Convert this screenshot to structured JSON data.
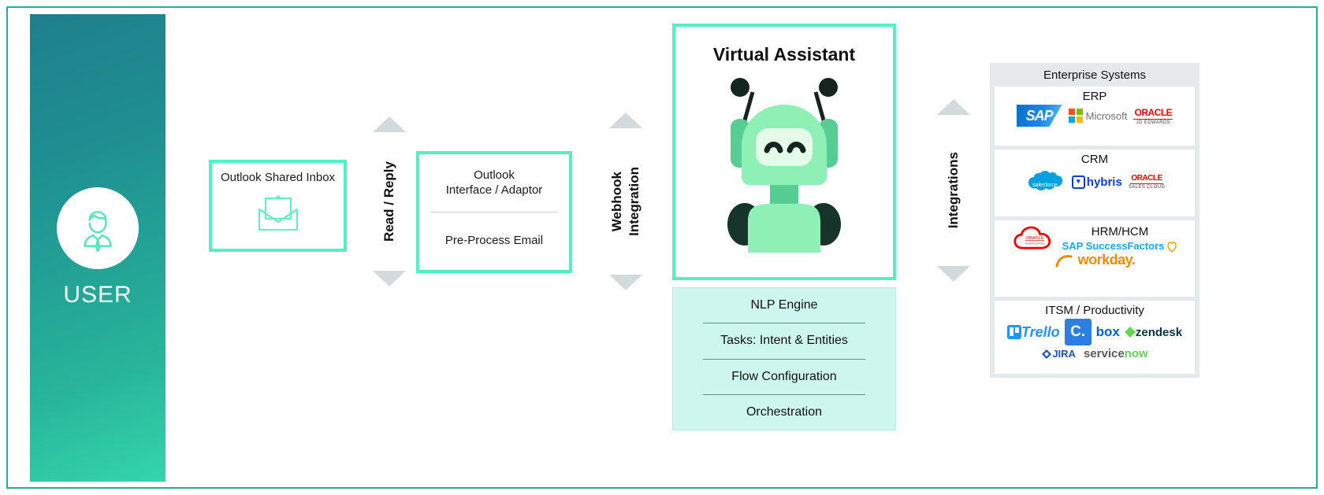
{
  "user": {
    "label": "USER",
    "icon": "user-avatar-icon"
  },
  "inbox": {
    "title": "Outlook Shared Inbox",
    "icon": "envelope-icon"
  },
  "read_reply": {
    "label": "Read / Reply",
    "arrow_up": "triangle-up-icon",
    "arrow_down": "triangle-down-icon"
  },
  "adaptor": {
    "title": "Outlook\nInterface / Adaptor",
    "subtitle": "Pre-Process Email"
  },
  "webhook": {
    "line1": "Webhook",
    "line2": "Integration",
    "arrow_up": "triangle-up-icon",
    "arrow_down": "triangle-down-icon"
  },
  "virtual_assistant": {
    "title": "Virtual Assistant",
    "robot_icon": "robot-icon"
  },
  "nlp": {
    "rows": [
      "NLP Engine",
      "Tasks: Intent & Entities",
      "Flow Configuration",
      "Orchestration"
    ]
  },
  "integrations": {
    "label": "Integrations",
    "arrow_up": "triangle-up-icon",
    "arrow_down": "triangle-down-icon"
  },
  "enterprise": {
    "header": "Enterprise Systems",
    "cards": [
      {
        "title": "ERP",
        "logos": [
          "SAP",
          "Microsoft",
          "ORACLE JD EDWARDS"
        ]
      },
      {
        "title": "CRM",
        "logos": [
          "salesforce",
          "hybris",
          "ORACLE SALES CLOUD"
        ]
      },
      {
        "title": "HRM/HCM",
        "logos": [
          "ORACLE HUMAN CAPITAL MANAGEMENT",
          "SAP SuccessFactors",
          "workday"
        ]
      },
      {
        "title": "ITSM / Productivity",
        "logos": [
          "Trello",
          "JIRA",
          "C.",
          "box",
          "zendesk",
          "servicenow"
        ]
      }
    ],
    "erp": {
      "sap": "SAP",
      "microsoft": "Microsoft",
      "oracle": "ORACLE",
      "oracle_sub": "JD EDWARDS"
    },
    "crm": {
      "salesforce": "salesforce",
      "hybris": "hybris",
      "hybris_mark": "▾",
      "oracle": "ORACLE",
      "oracle_sub": "SALES CLOUD"
    },
    "hrm": {
      "oracle": "ORACLE",
      "oracle_sub": "HUMAN CAPITAL",
      "oracle_sub2": "MANAGEMENT",
      "sapsf": "SAP SuccessFactors",
      "workday": "workday."
    },
    "itsm": {
      "trello": "Trello",
      "jira": "JIRA",
      "c_square": "C.",
      "box": "box",
      "zendesk": "zendesk",
      "servicenow_a": "service",
      "servicenow_b": "now"
    }
  },
  "colors": {
    "mint": "#52f0c4",
    "mint_fill": "#cdf7ee",
    "teal_frame": "#2aa9a0",
    "arrow_gray": "#d3dadb",
    "panel_gray": "#e6e9ea"
  }
}
